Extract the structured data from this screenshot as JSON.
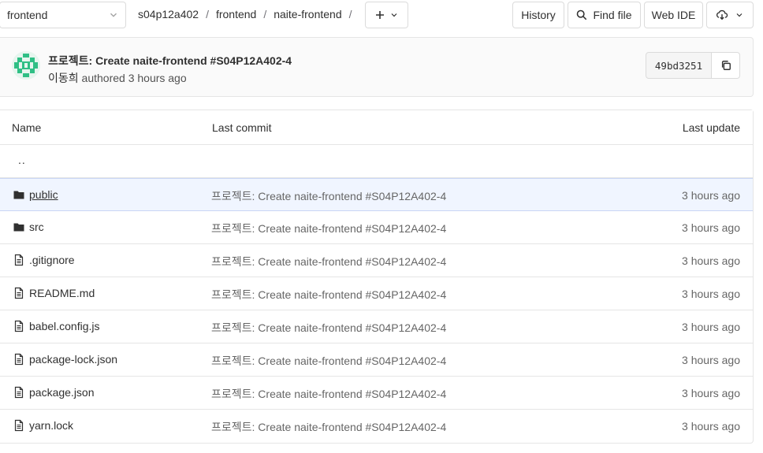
{
  "nav": {
    "branch": "frontend",
    "breadcrumb": [
      "s04p12a402",
      "frontend",
      "naite-frontend"
    ],
    "separator": "/",
    "history_label": "History",
    "find_file_label": "Find file",
    "web_ide_label": "Web IDE"
  },
  "last_commit": {
    "title": "프로젝트: Create naite-frontend #S04P12A402-4",
    "author": "이동희",
    "authored_text": "authored 3 hours ago",
    "sha": "49bd3251"
  },
  "table": {
    "headers": {
      "name": "Name",
      "last_commit": "Last commit",
      "last_update": "Last update"
    },
    "parent_label": "..",
    "rows": [
      {
        "name": "public",
        "type": "folder",
        "commit": "프로젝트: Create naite-frontend #S04P12A402-4",
        "updated": "3 hours ago"
      },
      {
        "name": "src",
        "type": "folder",
        "commit": "프로젝트: Create naite-frontend #S04P12A402-4",
        "updated": "3 hours ago"
      },
      {
        "name": ".gitignore",
        "type": "file",
        "commit": "프로젝트: Create naite-frontend #S04P12A402-4",
        "updated": "3 hours ago"
      },
      {
        "name": "README.md",
        "type": "file",
        "commit": "프로젝트: Create naite-frontend #S04P12A402-4",
        "updated": "3 hours ago"
      },
      {
        "name": "babel.config.js",
        "type": "file",
        "commit": "프로젝트: Create naite-frontend #S04P12A402-4",
        "updated": "3 hours ago"
      },
      {
        "name": "package-lock.json",
        "type": "file",
        "commit": "프로젝트: Create naite-frontend #S04P12A402-4",
        "updated": "3 hours ago"
      },
      {
        "name": "package.json",
        "type": "file",
        "commit": "프로젝트: Create naite-frontend #S04P12A402-4",
        "updated": "3 hours ago"
      },
      {
        "name": "yarn.lock",
        "type": "file",
        "commit": "프로젝트: Create naite-frontend #S04P12A402-4",
        "updated": "3 hours ago"
      }
    ]
  },
  "icons": {
    "branch_dropdown": "chevron-down-icon",
    "add": "plus-icon",
    "find": "search-icon",
    "clone": "cloud-download-icon",
    "copy": "copy-icon",
    "folder": "folder-icon",
    "file": "file-icon"
  },
  "colors": {
    "border": "#dbdbdb",
    "row_highlight": "#f0f5ff",
    "avatar": "#2fbf85"
  }
}
